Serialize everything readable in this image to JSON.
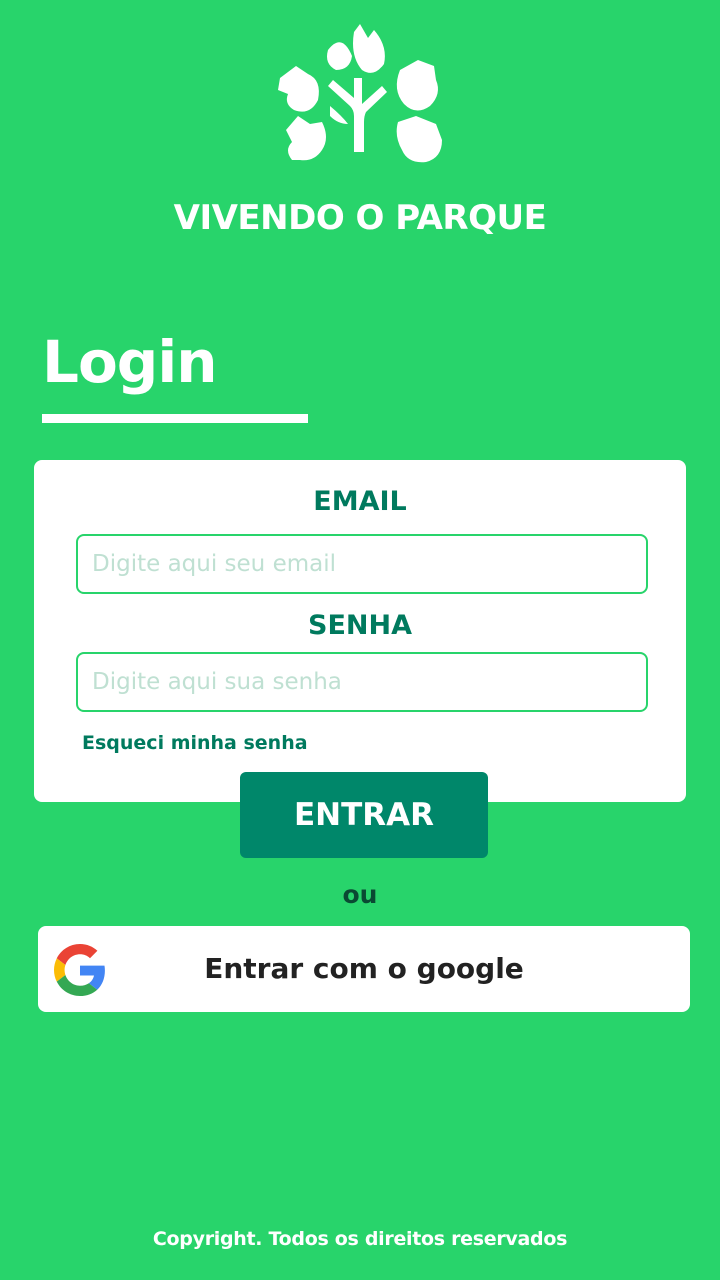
{
  "header": {
    "logo_icon": "tree-leaves-icon",
    "app_title": "VIVENDO O PARQUE"
  },
  "login": {
    "heading": "Login",
    "email_label": "EMAIL",
    "email_placeholder": "Digite aqui seu email",
    "email_value": "",
    "password_label": "SENHA",
    "password_placeholder": "Digite aqui sua senha",
    "password_value": "",
    "forgot_password": "Esqueci minha senha",
    "submit_label": "ENTRAR"
  },
  "alt_login": {
    "separator": "ou",
    "google_label": "Entrar com o google",
    "google_icon": "google-icon"
  },
  "footer": {
    "copyright": "Copyright. Todos os direitos reservados"
  },
  "colors": {
    "background": "#28d46b",
    "primary": "#00876a",
    "label": "#007a5e",
    "white": "#ffffff"
  }
}
